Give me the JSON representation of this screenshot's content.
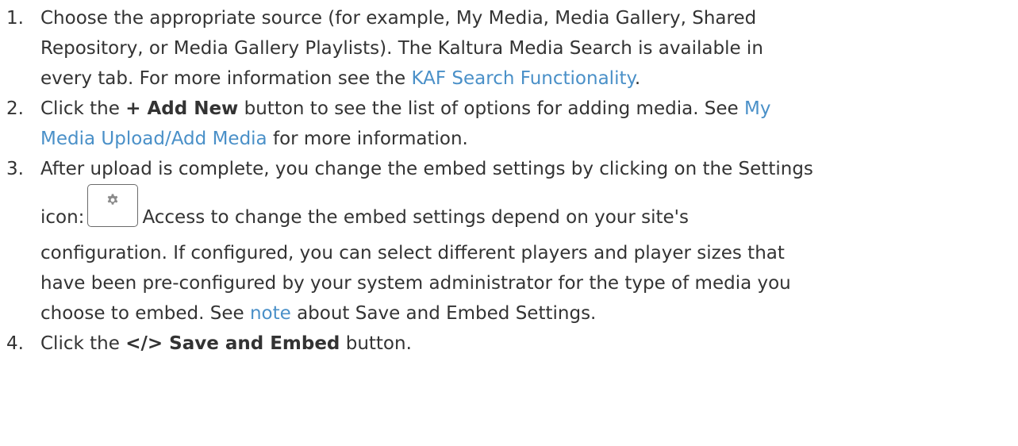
{
  "steps": [
    {
      "num": "1.",
      "l1": "Choose the appropriate source (for example, My Media, Media Gallery, Shared",
      "l2": "Repository, or Media Gallery Playlists). The Kaltura Media Search is available in",
      "l3a": "every tab. For more information see the ",
      "l3link": "KAF Search Functionality",
      "l3b": "."
    },
    {
      "num": "2.",
      "l1a": "Click the ",
      "l1bold": "+ Add New",
      "l1b": " button to see the list of options for adding media. See ",
      "l1link": "My",
      "l2link": "Media Upload/Add Media",
      "l2b": " for more information."
    },
    {
      "num": "3.",
      "l1": "After upload is complete, you change the embed settings by clicking on the Settings",
      "l2a": "icon:",
      "l2b": "Access to change the embed settings depend on your site's",
      "l3": "configuration. If configured, you can select different players and player sizes that",
      "l4": "have been pre-configured by your system administrator for the type of media you",
      "l5a": "choose to embed. See ",
      "l5link": "note",
      "l5b": " about Save and Embed Settings."
    },
    {
      "num": "4.",
      "l1a": "Click the ",
      "l1bold": "</> Save and Embed",
      "l1b": " button."
    }
  ],
  "icons": {
    "settings": "gear-icon"
  },
  "colors": {
    "text": "#333333",
    "link": "#4a90c8"
  }
}
